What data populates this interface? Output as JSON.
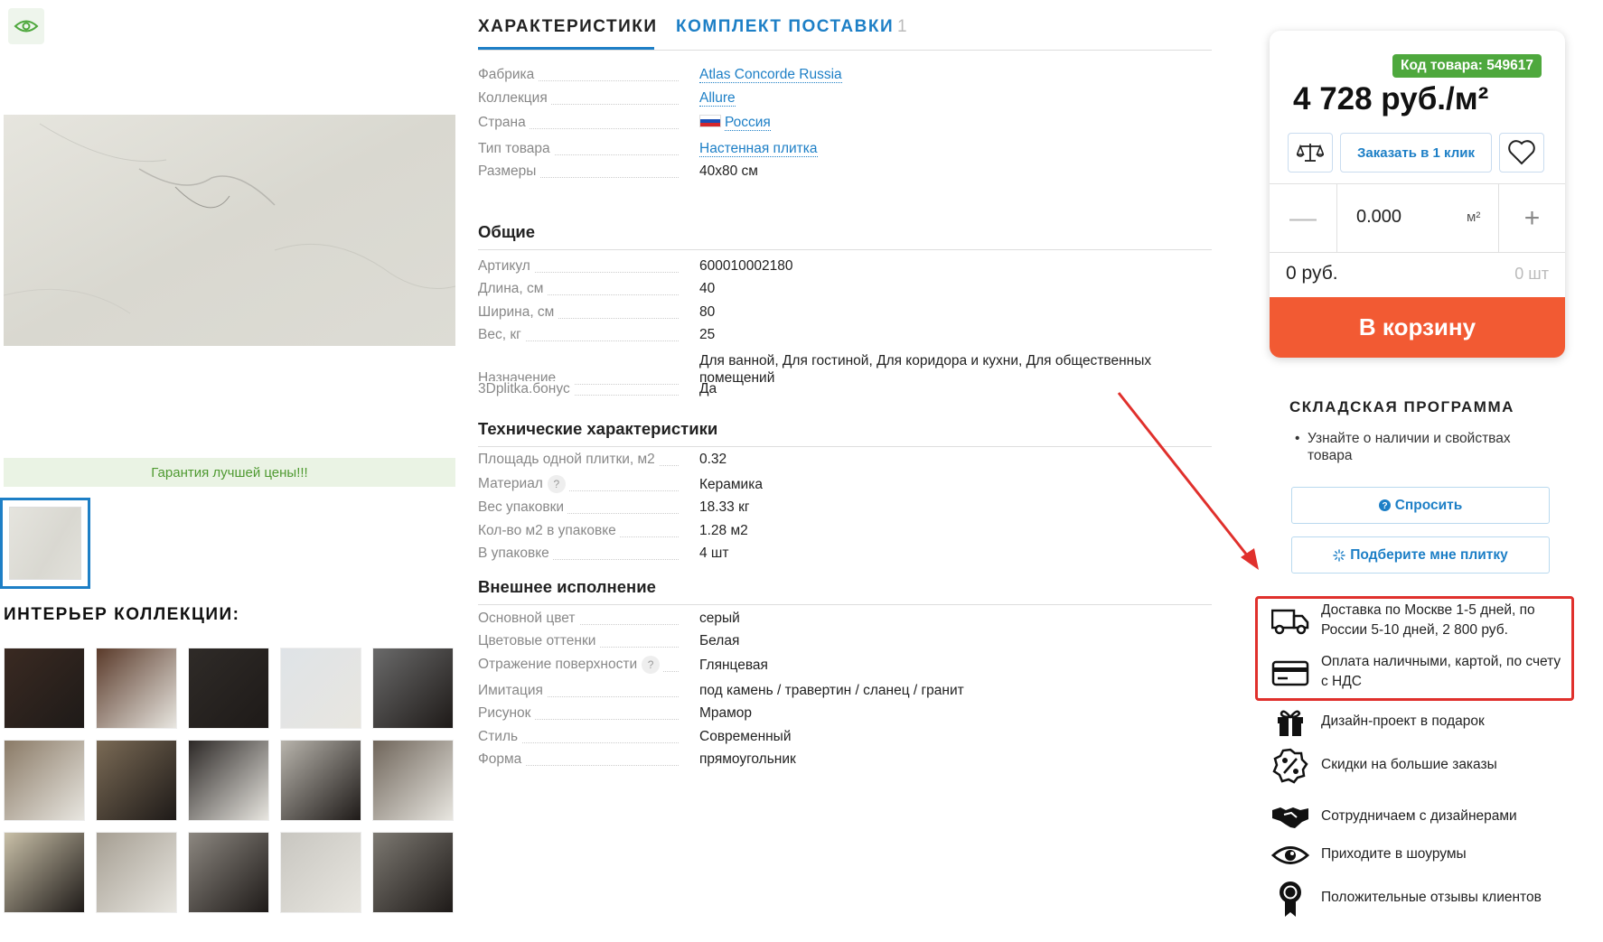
{
  "gallery": {
    "guarantee": "Гарантия лучшей цены!!!",
    "interior_title": "ИНТЕРЬЕР КОЛЛЕКЦИИ:",
    "interior_images": [
      {
        "icon": "interior-photo-1",
        "color": "#3a2a22"
      },
      {
        "icon": "interior-photo-2",
        "color": "#5a3a2a"
      },
      {
        "icon": "interior-photo-3",
        "color": "#2f2b28"
      },
      {
        "icon": "interior-photo-4",
        "color": "#dfe3e7"
      },
      {
        "icon": "interior-photo-5",
        "color": "#6a6a6a"
      },
      {
        "icon": "interior-photo-6",
        "color": "#8a7a66"
      },
      {
        "icon": "interior-photo-7",
        "color": "#7a6a55"
      },
      {
        "icon": "interior-photo-8",
        "color": "#2c2826"
      },
      {
        "icon": "interior-photo-9",
        "color": "#b8b4ac"
      },
      {
        "icon": "interior-photo-10",
        "color": "#6f655a"
      },
      {
        "icon": "interior-photo-11",
        "color": "#c9c0a8"
      },
      {
        "icon": "interior-photo-12",
        "color": "#a59e92"
      },
      {
        "icon": "interior-photo-13",
        "color": "#8c8780"
      },
      {
        "icon": "interior-photo-14",
        "color": "#c8c6c0"
      },
      {
        "icon": "interior-photo-15",
        "color": "#7d7972"
      }
    ]
  },
  "tabs": [
    {
      "label": "ХАРАКТЕРИСТИКИ",
      "active": true
    },
    {
      "label": "КОМПЛЕКТ ПОСТАВКИ",
      "count": "1"
    }
  ],
  "specs": {
    "rows": [
      {
        "label": "Фабрика",
        "value": "Atlas Concorde Russia",
        "link": true
      },
      {
        "label": "Коллекция",
        "value": "Allure",
        "link": true
      },
      {
        "label": "Страна",
        "value": "Россия",
        "link": true,
        "flag": true
      },
      {
        "label": "Тип товара",
        "value": "Настенная плитка",
        "link": true
      },
      {
        "label": "Размеры",
        "value": "40x80 см"
      }
    ],
    "general_title": "Общие",
    "general": [
      {
        "label": "Артикул",
        "value": "600010002180"
      },
      {
        "label": "Длина, см",
        "value": "40"
      },
      {
        "label": "Ширина, см",
        "value": "80"
      },
      {
        "label": "Вес, кг",
        "value": "25"
      },
      {
        "label": "Назначение",
        "value": "Для ванной, Для гостиной, Для коридора и кухни, Для общественных помещений"
      },
      {
        "label": "3Dplitka.бонус",
        "value": "Да"
      }
    ],
    "tech_title": "Технические характеристики",
    "tech": [
      {
        "label": "Площадь одной плитки, м2",
        "value": "0.32"
      },
      {
        "label": "Материал",
        "value": "Керамика",
        "help": "?"
      },
      {
        "label": "Вес упаковки",
        "value": "18.33 кг"
      },
      {
        "label": "Кол-во м2 в упаковке",
        "value": "1.28 м2"
      },
      {
        "label": "В упаковке",
        "value": "4 шт"
      }
    ],
    "look_title": "Внешнее исполнение",
    "look": [
      {
        "label": "Основной цвет",
        "value": "серый"
      },
      {
        "label": "Цветовые оттенки",
        "value": "Белая"
      },
      {
        "label": "Отражение поверхности",
        "value": "Глянцевая",
        "help": "?"
      },
      {
        "label": "Имитация",
        "value": "под камень / травертин / сланец / гранит"
      },
      {
        "label": "Рисунок",
        "value": "Мрамор"
      },
      {
        "label": "Стиль",
        "value": "Современный"
      },
      {
        "label": "Форма",
        "value": "прямоугольник"
      }
    ]
  },
  "buy": {
    "code": "Код товара: 549617",
    "price": "4 728 руб./м²",
    "one_click": "Заказать в 1 клик",
    "qty_minus": "—",
    "qty_value": "0.000",
    "qty_unit": "м²",
    "qty_plus": "+",
    "sum": "0 руб.",
    "pieces": "0 шт",
    "cart": "В корзину"
  },
  "stock": {
    "title": "СКЛАДСКАЯ ПРОГРАММА",
    "bullet": "Узнайте о наличии и свойствах товара",
    "ask": "Спросить",
    "pick": "Подберите мне плитку"
  },
  "features": [
    {
      "icon": "truck-icon",
      "text": "Доставка по Москве 1-5 дней, по России 5-10 дней, 2 800 руб."
    },
    {
      "icon": "credit-card-icon",
      "text": "Оплата наличными, картой, по счету с НДС"
    },
    {
      "icon": "gift-icon",
      "text": "Дизайн-проект в подарок"
    },
    {
      "icon": "percent-badge-icon",
      "text": "Скидки на большие заказы"
    },
    {
      "icon": "handshake-icon",
      "text": "Сотрудничаем с дизайнерами"
    },
    {
      "icon": "eye-icon",
      "text": "Приходите в шоурумы"
    },
    {
      "icon": "award-ribbon-icon",
      "text": "Положительные отзывы клиентов"
    }
  ],
  "colors": {
    "accent_blue": "#1d7fc6",
    "cart_orange": "#f25a33",
    "code_green": "#4ea83d",
    "highlight_red": "#e0302c"
  }
}
